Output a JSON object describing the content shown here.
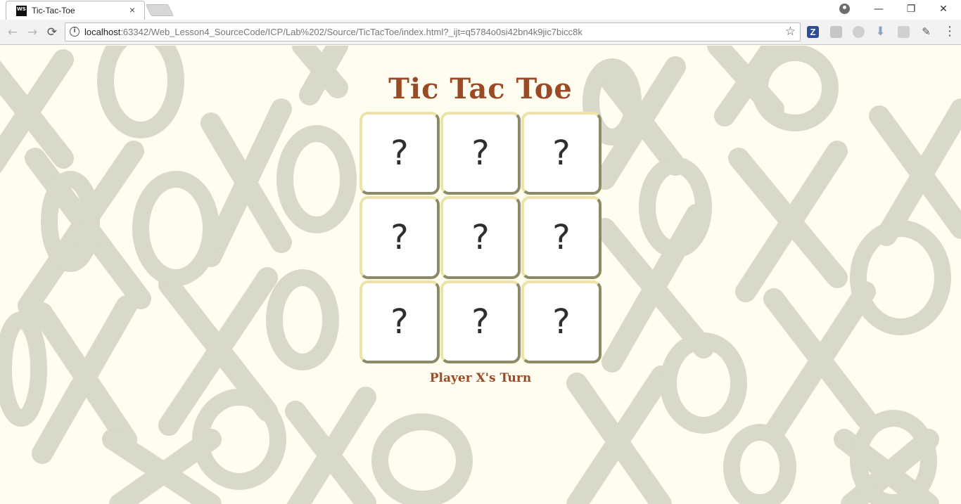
{
  "browser": {
    "tab_title": "Tic-Tac-Toe",
    "favicon_text": "WS",
    "tab_close": "×",
    "url_host": "localhost",
    "url_rest": ":63342/Web_Lesson4_SourceCode/ICP/Lab%202/Source/TicTacToe/index.html?_ijt=q5784o0si42bn4k9jic7bicc8k",
    "back_icon": "←",
    "forward_icon": "→",
    "reload_icon": "⟳",
    "info_icon": "i",
    "star_icon": "☆",
    "extension_z": "Z",
    "download_icon": "⬇",
    "eyedropper_icon": "✎",
    "menu_icon": "⋮",
    "minimize_icon": "—",
    "restore_icon": "❐",
    "close_icon": "✕"
  },
  "game": {
    "title": "Tic Tac Toe",
    "cells": [
      "?",
      "?",
      "?",
      "?",
      "?",
      "?",
      "?",
      "?",
      "?"
    ],
    "status": "Player X's Turn"
  },
  "colors": {
    "title": "#9b4a26",
    "background": "#fffdf0",
    "pattern": "#d9d9c9",
    "cell_border_light": "#ebe3a8",
    "cell_border_dark": "#8e8a66"
  }
}
